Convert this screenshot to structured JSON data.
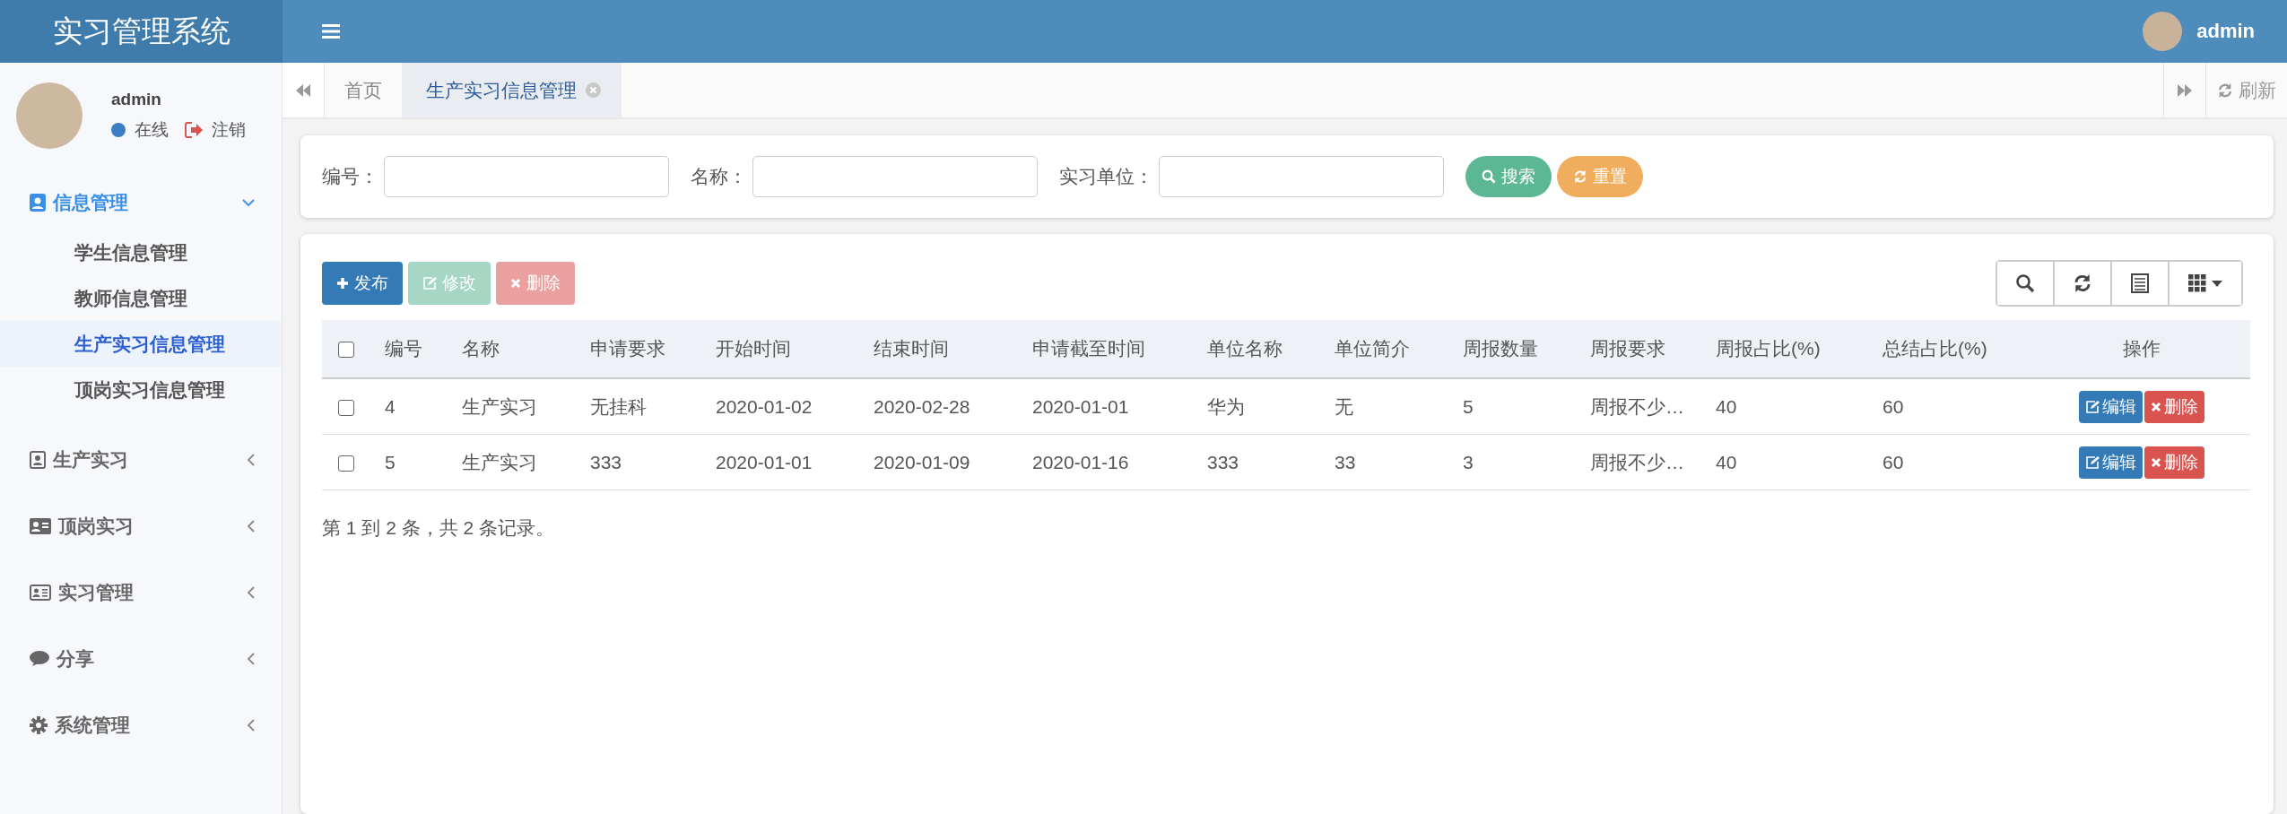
{
  "header": {
    "title": "实习管理系统",
    "user": "admin"
  },
  "sidebar": {
    "user": {
      "name": "admin",
      "status": "在线",
      "logout": "注销"
    },
    "menu": [
      {
        "label": "信息管理",
        "expanded": true,
        "children": [
          {
            "label": "学生信息管理",
            "selected": false
          },
          {
            "label": "教师信息管理",
            "selected": false
          },
          {
            "label": "生产实习信息管理",
            "selected": true
          },
          {
            "label": "顶岗实习信息管理",
            "selected": false
          }
        ]
      },
      {
        "label": "生产实习",
        "expanded": false
      },
      {
        "label": "顶岗实习",
        "expanded": false
      },
      {
        "label": "实习管理",
        "expanded": false
      },
      {
        "label": "分享",
        "expanded": false
      },
      {
        "label": "系统管理",
        "expanded": false
      }
    ]
  },
  "tabs": [
    {
      "label": "首页",
      "selected": false,
      "closable": false
    },
    {
      "label": "生产实习信息管理",
      "selected": true,
      "closable": true
    }
  ],
  "refresh": "刷新",
  "search": {
    "fields": [
      {
        "label": "编号："
      },
      {
        "label": "名称："
      },
      {
        "label": "实习单位："
      }
    ],
    "buttons": [
      {
        "label": "搜索",
        "kind": "search"
      },
      {
        "label": "重置",
        "kind": "reset"
      }
    ]
  },
  "toolbar": [
    {
      "label": "发布",
      "kind": "add",
      "disabled": false
    },
    {
      "label": "修改",
      "kind": "edit",
      "disabled": true
    },
    {
      "label": "删除",
      "kind": "delete",
      "disabled": true
    }
  ],
  "table": {
    "header_checked": false,
    "columns": [
      "编号",
      "名称",
      "申请要求",
      "开始时间",
      "结束时间",
      "申请截至时间",
      "单位名称",
      "单位简介",
      "周报数量",
      "周报要求",
      "周报占比(%)",
      "总结占比(%)",
      "操作"
    ],
    "rows": [
      {
        "checked": false,
        "cells": [
          "4",
          "生产实习",
          "无挂科",
          "2020-01-02",
          "2020-02-28",
          "2020-01-01",
          "华为",
          "无",
          "5",
          "周报不少…",
          "40",
          "60"
        ],
        "actions": [
          "编辑",
          "删除"
        ]
      },
      {
        "checked": false,
        "cells": [
          "5",
          "生产实习",
          "333",
          "2020-01-01",
          "2020-01-09",
          "2020-01-16",
          "333",
          "33",
          "3",
          "周报不少…",
          "40",
          "60"
        ],
        "actions": [
          "编辑",
          "删除"
        ]
      }
    ]
  },
  "footer": "第 1 到 2 条，共 2 条记录。"
}
